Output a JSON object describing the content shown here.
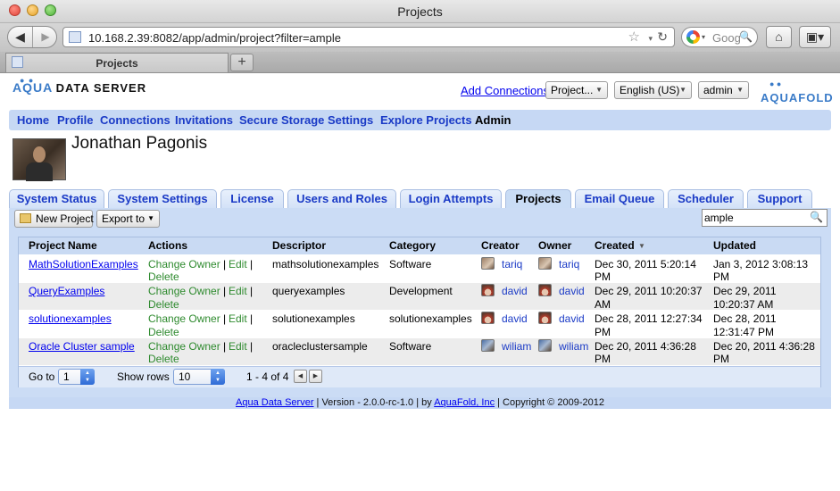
{
  "window": {
    "title": "Projects"
  },
  "browser": {
    "url": "10.168.2.39:8082/app/admin/project?filter=ample",
    "search_placeholder": "Goog",
    "tab_title": "Projects",
    "new_tab": "+"
  },
  "header": {
    "logo_left_aqua": "AQUA",
    "logo_left_rest": "DATA SERVER",
    "logo_right": "AQUAFOLD",
    "add_connections": "Add Connections",
    "project_select": "Project...",
    "language_select": "English (US)",
    "user_select": "admin"
  },
  "nav": {
    "items": [
      "Home",
      "Profile",
      "Connections",
      "Invitations",
      "Secure Storage",
      "Settings",
      "Explore Projects",
      "Admin"
    ],
    "active": "Admin"
  },
  "user": {
    "name": "Jonathan Pagonis"
  },
  "admin_tabs": {
    "items": [
      "System Status",
      "System Settings",
      "License",
      "Users and Roles",
      "Login Attempts",
      "Projects",
      "Email Queue",
      "Scheduler",
      "Support"
    ],
    "active": "Projects"
  },
  "actions": {
    "new_project": "New Project",
    "export_to": "Export to",
    "filter_value": "ample"
  },
  "table": {
    "columns": [
      "Project Name",
      "Actions",
      "Descriptor",
      "Category",
      "Creator",
      "Owner",
      "Created",
      "Updated"
    ],
    "sort_column": "Created",
    "action_change_owner": "Change Owner",
    "action_sep": "|",
    "action_edit": "Edit",
    "action_delete": "Delete",
    "rows": [
      {
        "name": "MathSolutionExamples",
        "descriptor": "mathsolutionexamples",
        "category": "Software",
        "creator": "tariq",
        "owner": "tariq",
        "created_1": "Dec 30, 2011 5:20:14",
        "created_2": "PM",
        "updated_1": "Jan 3, 2012 3:08:13",
        "updated_2": "PM"
      },
      {
        "name": "QueryExamples",
        "descriptor": "queryexamples",
        "category": "Development",
        "creator": "david",
        "owner": "david",
        "created_1": "Dec 29, 2011 10:20:37",
        "created_2": "AM",
        "updated_1": "Dec 29, 2011",
        "updated_2": "10:20:37 AM"
      },
      {
        "name": "solutionexamples",
        "descriptor": "solutionexamples",
        "category": "solutionexamples",
        "creator": "david",
        "owner": "david",
        "created_1": "Dec 28, 2011 12:27:34",
        "created_2": "PM",
        "updated_1": "Dec 28, 2011",
        "updated_2": "12:31:47 PM"
      },
      {
        "name": "Oracle Cluster sample",
        "descriptor": "oracleclustersample",
        "category": "Software",
        "creator": "wiliam",
        "owner": "wiliam",
        "created_1": "Dec 20, 2011 4:36:28",
        "created_2": "PM",
        "updated_1": "Dec 20, 2011 4:36:28",
        "updated_2": "PM"
      }
    ]
  },
  "pager": {
    "goto_label": "Go to",
    "goto_value": "1",
    "show_rows_label": "Show rows",
    "show_rows_value": "10",
    "range": "1 - 4 of 4"
  },
  "footer": {
    "product_link": "Aqua Data Server",
    "version_text": " | Version - 2.0.0-rc-1.0 | by ",
    "company_link": "AquaFold, Inc",
    "copyright": " | Copyright © 2009-2012"
  }
}
